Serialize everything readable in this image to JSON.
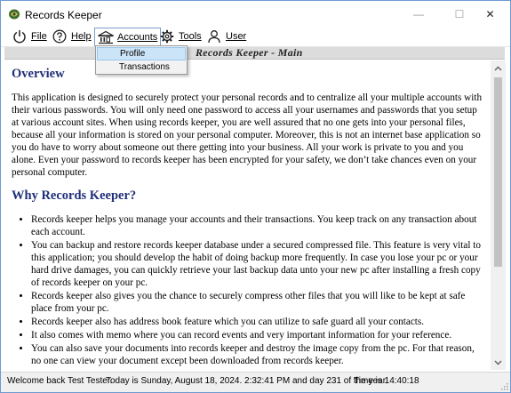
{
  "window": {
    "title": "Records Keeper",
    "min_glyph": "—",
    "max_glyph": "☐",
    "close_glyph": "✕"
  },
  "menu": {
    "file": "File",
    "help": "Help",
    "accounts": "Accounts",
    "tools": "Tools",
    "user": "User"
  },
  "dropdown": {
    "items": [
      {
        "label": "Profile",
        "selected": true
      },
      {
        "label": "Transactions",
        "selected": false
      }
    ]
  },
  "banner": {
    "title": "Records Keeper - Main"
  },
  "content": {
    "overview_heading": "Overview",
    "overview_text": "This application is designed to securely protect your personal records and to centralize all your multiple accounts with their various passwords. You will only need one password to access all your usernames and passwords that you setup at various account sites. When using records keeper, you are well assured that no one gets into your personal files, because all your information is stored on your personal computer. Moreover, this is not an internet base application so you do have to worry about someone out there getting into your business. All your work is private to you and you alone. Even your password to records keeper has been encrypted for your safety, we don’t take chances even on your personal computer.",
    "why_heading": "Why Records Keeper?",
    "bullets": [
      "Records keeper helps you manage your accounts and their transactions. You keep track on any transaction about each account.",
      "You can backup and restore records keeper database under a secured compressed file. This feature is very vital to this application; you should develop the habit of doing backup more frequently. In case you lose your pc or your hard drive damages, you can quickly retrieve your last backup data unto your new pc after installing a fresh copy of records keeper on your pc.",
      "Records keeper also gives you the chance to securely compress other files that you will like to be kept at safe place from your pc.",
      "Records keeper also has address book feature which you can utilize to safe guard all your contacts.",
      "It also comes with memo where you can record events and very important information for your reference.",
      "You can also save your documents into records keeper and destroy the image copy from the pc. For that reason, no one can view your document except been downloaded from records keeper."
    ]
  },
  "status": {
    "welcome": "Welcome back Test Tester.",
    "date": "Today is Sunday, August 18, 2024. 2:32:41 PM and day 231 of the year.",
    "time": "Time is 14:40:18"
  },
  "colors": {
    "heading": "#1f2f78",
    "menu_highlight": "#cce4f7",
    "banner_bg": "#dcdcdc"
  }
}
